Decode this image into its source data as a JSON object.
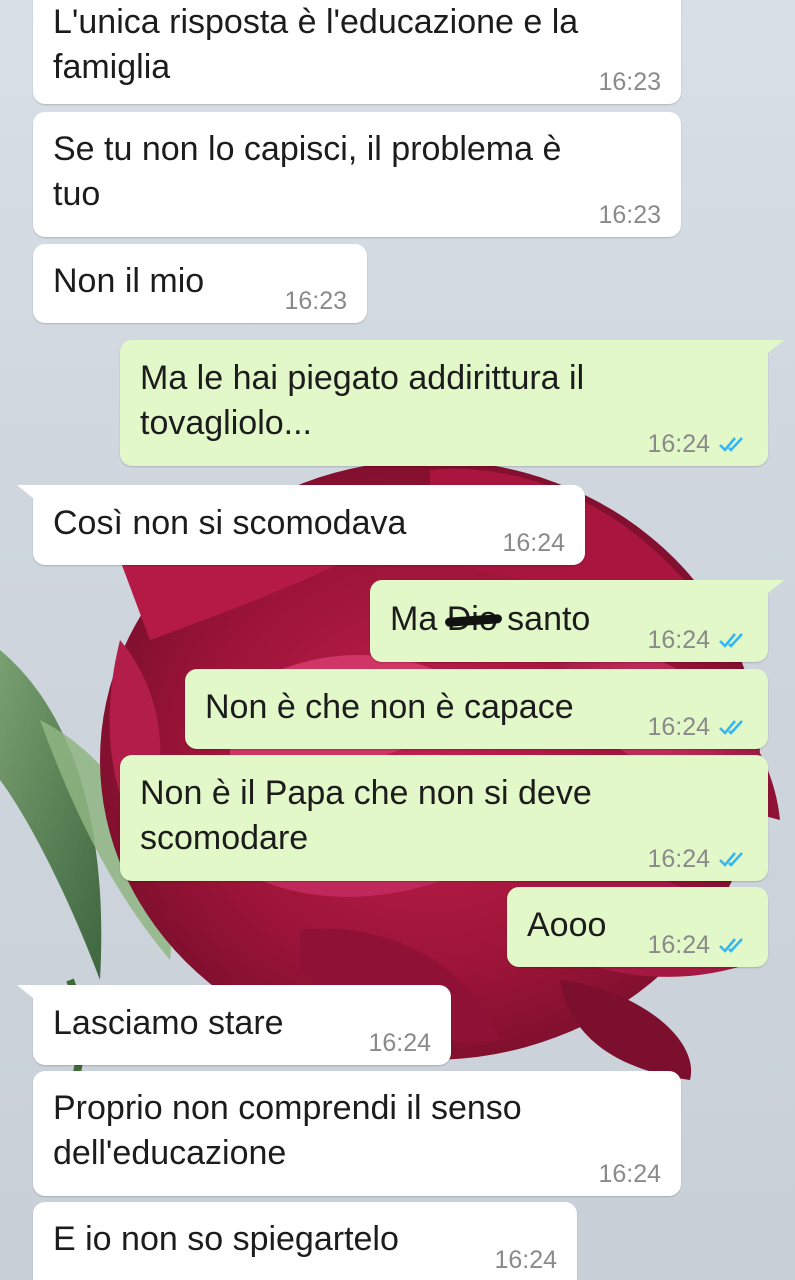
{
  "colors": {
    "incoming_bubble": "#ffffff",
    "outgoing_bubble": "#e2f8c9",
    "read_tick": "#34b7f1",
    "timestamp": "#8a8a8a"
  },
  "messages": [
    {
      "direction": "in",
      "lines": [
        "L'unica risposta è l'educazione e la",
        "famiglia"
      ],
      "time": "16:23"
    },
    {
      "direction": "in",
      "lines": [
        "Se tu non lo capisci, il problema è",
        "tuo"
      ],
      "time": "16:23"
    },
    {
      "direction": "in",
      "lines": [
        "Non il mio"
      ],
      "time": "16:23"
    },
    {
      "direction": "out",
      "lines": [
        "Ma le hai piegato addirittura il",
        "tovagliolo..."
      ],
      "time": "16:24",
      "status_icon": "double-check-read-icon"
    },
    {
      "direction": "in",
      "lines": [
        "Così non si scomodava"
      ],
      "time": "16:24"
    },
    {
      "direction": "out",
      "parts": {
        "before": "Ma",
        "redacted": "Dio",
        "after": "santo"
      },
      "time": "16:24",
      "status_icon": "double-check-read-icon"
    },
    {
      "direction": "out",
      "lines": [
        "Non è che non è capace"
      ],
      "time": "16:24",
      "status_icon": "double-check-read-icon"
    },
    {
      "direction": "out",
      "lines": [
        "Non è il Papa che non si deve",
        "scomodare"
      ],
      "time": "16:24",
      "status_icon": "double-check-read-icon"
    },
    {
      "direction": "out",
      "lines": [
        "Aooo"
      ],
      "time": "16:24",
      "status_icon": "double-check-read-icon"
    },
    {
      "direction": "in",
      "lines": [
        "Lasciamo stare"
      ],
      "time": "16:24"
    },
    {
      "direction": "in",
      "lines": [
        "Proprio non comprendi il senso",
        "dell'educazione"
      ],
      "time": "16:24"
    },
    {
      "direction": "in",
      "lines": [
        "E io non so spiegartelo"
      ],
      "time": "16:24"
    }
  ]
}
